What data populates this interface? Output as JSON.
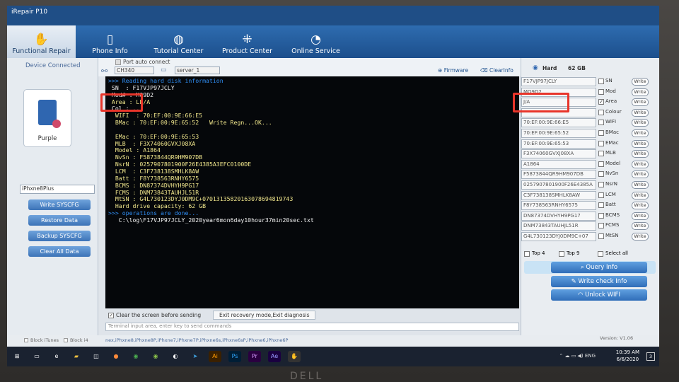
{
  "window": {
    "title": "iRepair P10"
  },
  "tabs": [
    {
      "label": "Functional Repair",
      "icon": "repair-hand-icon"
    },
    {
      "label": "Phone Info",
      "icon": "phone-icon"
    },
    {
      "label": "Tutorial Center",
      "icon": "globe-icon"
    },
    {
      "label": "Product Center",
      "icon": "grid-icon"
    },
    {
      "label": "Online Service",
      "icon": "chat-icon"
    }
  ],
  "left": {
    "device_status": "Device Connected",
    "device_name": "Purple",
    "model_select": "iPhxne8Plus",
    "buttons": [
      "Write SYSCFG",
      "Restore Data",
      "Backup SYSCFG",
      "Clear All Data"
    ]
  },
  "toolbar": {
    "port_auto_connect": "Port auto connect",
    "port": "CH340",
    "server": "server_1",
    "firmware": "Firmware",
    "clear_info": "ClearInfo"
  },
  "terminal": {
    "lines": [
      {
        "text": ">>> Reading hard disk information",
        "c": "blue"
      },
      {
        "text": " SN  : F17VJP97JCLY",
        "c": "white"
      },
      {
        "text": " Mod# : MQ9D2",
        "c": "white"
      },
      {
        "text": " Area : LL/A",
        "c": "yel"
      },
      {
        "text": " Col : ...",
        "c": "white"
      },
      {
        "text": "  WIFI  : 70:EF:00:9E:66:E5",
        "c": "yel"
      },
      {
        "text": "  BMac : 70:EF:00:9E:65:52   Write Regn...OK...",
        "c": "yel"
      },
      {
        "text": "",
        "c": "white"
      },
      {
        "text": "  EMac : 70:EF:00:9E:65:53",
        "c": "yel"
      },
      {
        "text": "  MLB  : F3X74060GVXJ08XA",
        "c": "yel"
      },
      {
        "text": "  Model : A1864",
        "c": "yel"
      },
      {
        "text": "  NvSn : F5873844QR9HM907DB",
        "c": "yel"
      },
      {
        "text": "  NsrN : 0257907801900F26E4385A3EFC0100DE",
        "c": "yel"
      },
      {
        "text": "  LCM  : C3F738138SMHLK8AW",
        "c": "yel"
      },
      {
        "text": "  Batt : F8Y738563RNHY6575",
        "c": "yel"
      },
      {
        "text": "  BCMS : DN87374DVHYH9PG17",
        "c": "yel"
      },
      {
        "text": "  FCMS : DNM73843TAUHJL51R",
        "c": "yel"
      },
      {
        "text": "  MtSN : G4L730123DYJ0DM9C+0701313582016307869481974​3",
        "c": "yel"
      },
      {
        "text": "  Hard drive capacity: 62 GB",
        "c": "yel"
      },
      {
        "text": ">>> operations are done...",
        "c": "blue"
      },
      {
        "text": "   C:\\log\\F17VJP97JCLY_2020year6mon6day10hour37min20sec.txt",
        "c": "white"
      }
    ]
  },
  "bottom": {
    "clear_screen": "Clear the screen before sending",
    "exit_recovery": "Exit recovery mode,Exit diagnosis",
    "input_placeholder": "Terminal input area, enter key to send commands",
    "block_itunes": "Block iTunes",
    "block_i4": "Block i4",
    "models": "nex,iPhxne8,iPhxne8P,iPhxne7,iPhxne7P,iPhxne6s,iPhxne6sP,iPhxne6,iPhxne6P",
    "version": "Version: V1.06"
  },
  "right": {
    "hard_label": "Hard",
    "hard_size": "62 GB",
    "rows": [
      {
        "value": "F17VJP97JCLY",
        "label": "SN",
        "checked": false
      },
      {
        "value": "MQ9D2",
        "label": "Mod",
        "checked": false
      },
      {
        "value": "J/A",
        "label": "Area",
        "checked": true
      },
      {
        "value": "",
        "label": "Colour",
        "checked": false
      },
      {
        "value": "70:EF:00:9E:66:E5",
        "label": "WIFI",
        "checked": false
      },
      {
        "value": "70:EF:00:9E:65:52",
        "label": "BMac",
        "checked": false
      },
      {
        "value": "70:EF:00:9E:65:53",
        "label": "EMac",
        "checked": false
      },
      {
        "value": "F3X74060GVXJ08XA",
        "label": "MLB",
        "checked": false
      },
      {
        "value": "A1864",
        "label": "Model",
        "checked": false
      },
      {
        "value": "F5873844QR9HM907DB",
        "label": "NvSn",
        "checked": false
      },
      {
        "value": "0257907801900F26E4385A",
        "label": "NsrN",
        "checked": false
      },
      {
        "value": "C3F738138SMHLK8AW",
        "label": "LCM",
        "checked": false
      },
      {
        "value": "F8Y738563RNHY6575",
        "label": "Batt",
        "checked": false
      },
      {
        "value": "DN87374DVHYH9PG17",
        "label": "BCMS",
        "checked": false
      },
      {
        "value": "DNM73843TAUHJL51R",
        "label": "FCMS",
        "checked": false
      },
      {
        "value": "G4L730123DYJ0DM9C+07",
        "label": "MtSN",
        "checked": false
      }
    ],
    "write_label": "Write",
    "top4": "Top 4",
    "top9": "Top 9",
    "select_all": "Select all",
    "query": "Query Info",
    "write_check": "Write check Info",
    "unlock_wifi": "Unlock WIFI"
  },
  "taskbar": {
    "time": "10:39 AM",
    "date": "6/6/2020",
    "lang": "ENG",
    "badge": "3"
  },
  "monitor_brand": "DELL"
}
